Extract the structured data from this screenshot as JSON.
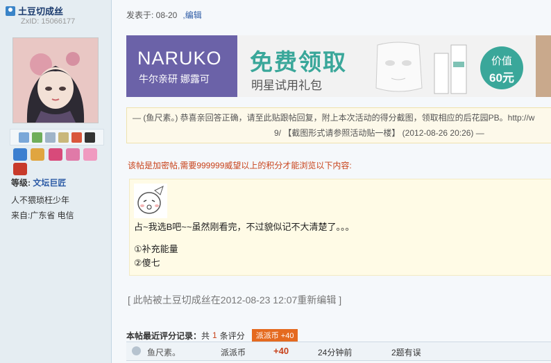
{
  "user": {
    "name": "土豆切成丝",
    "zxid": "ZxID: 15066177",
    "grade_label": "等级:",
    "grade_value": "文坛巨匠",
    "motto": "人不猥琐枉少年",
    "from": "来自:广东省 电信"
  },
  "post": {
    "posted": "发表于: 08-20",
    "edit_link": ",编辑",
    "banner": {
      "brand_logo": "NARUKO",
      "brand_sub": "牛尔亲研 娜露可",
      "headline": "免费领取",
      "subline": "明星试用礼包",
      "value_top": "价值",
      "value_bottom": "60元"
    },
    "notice_line1": "— (鱼尺素。) 恭喜亲回答正确，请至此贴跟帖回复，附上本次活动的得分截图，领取相应的后花园PB。http://w",
    "notice_line2": "9/ 【截图形式请参照活动贴一楼】 (2012-08-26 20:26) —",
    "lock_message": "该帖是加密帖,需要999999威望以上的积分才能浏览以下内容:",
    "quote": {
      "reply": "占~我选B吧~~虽然刚看完，不过貌似记不大清楚了。。。",
      "option1": "①补充能量",
      "option2": "②傻七"
    },
    "edit_note": "[ 此帖被土豆切成丝在2012-08-23 12:07重新编辑 ]"
  },
  "rating": {
    "head_label": "本帖最近评分记录：",
    "count_prefix": "共",
    "count": "1",
    "count_suffix": "条评分",
    "badge": "派派币 +40",
    "row": {
      "user": "鱼尺素。",
      "currency": "派派币",
      "amount": "+40",
      "time": "24分钟前",
      "reason": "2题有误"
    }
  },
  "colors": {
    "accent_blue": "#2b5aa5",
    "warning_red": "#c8421a",
    "banner_teal": "#3aa79a",
    "brand_purple": "#6b62a8"
  }
}
